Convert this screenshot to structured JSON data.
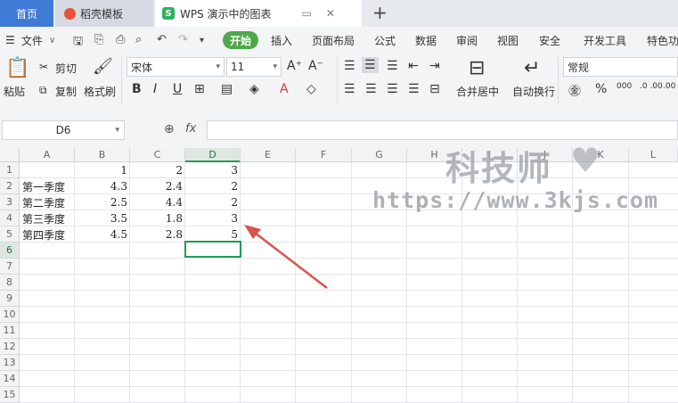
{
  "tabs": {
    "home": "首页",
    "template": "稻壳模板",
    "document": "WPS 演示中的图表"
  },
  "menu": {
    "file": "文件",
    "start": "开始",
    "items": [
      "插入",
      "页面布局",
      "公式",
      "数据",
      "审阅",
      "视图",
      "安全",
      "开发工具",
      "特色功"
    ]
  },
  "ribbon": {
    "paste": "粘贴",
    "cut": "剪切",
    "copy": "复制",
    "format_painter": "格式刷",
    "font_name": "宋体",
    "font_size": "11",
    "merge_center": "合并居中",
    "wrap_text": "自动换行",
    "number_format": "常规"
  },
  "formula_bar": {
    "name_box": "D6",
    "fx": "fx",
    "value": ""
  },
  "columns": [
    "A",
    "B",
    "C",
    "D",
    "E",
    "F",
    "G",
    "H",
    "I",
    "J",
    "K",
    "L"
  ],
  "rows": [
    "1",
    "2",
    "3",
    "4",
    "5",
    "6",
    "7",
    "8",
    "9",
    "10",
    "11",
    "12",
    "13",
    "14",
    "15"
  ],
  "cells": {
    "B1": "1",
    "C1": "2",
    "D1": "3",
    "A2": "第一季度",
    "B2": "4.3",
    "C2": "2.4",
    "D2": "2",
    "A3": "第二季度",
    "B3": "2.5",
    "C3": "4.4",
    "D3": "2",
    "A4": "第三季度",
    "B4": "3.5",
    "C4": "1.8",
    "D4": "3",
    "A5": "第四季度",
    "B5": "4.5",
    "C5": "2.8",
    "D5": "5"
  },
  "watermark": {
    "title": "科技师",
    "url": "https://www.3kjs.com"
  },
  "colors": {
    "accent": "#3e7ad6",
    "start_button": "#4da84a",
    "selection": "#1f9d55",
    "arrow": "#d9534f"
  }
}
